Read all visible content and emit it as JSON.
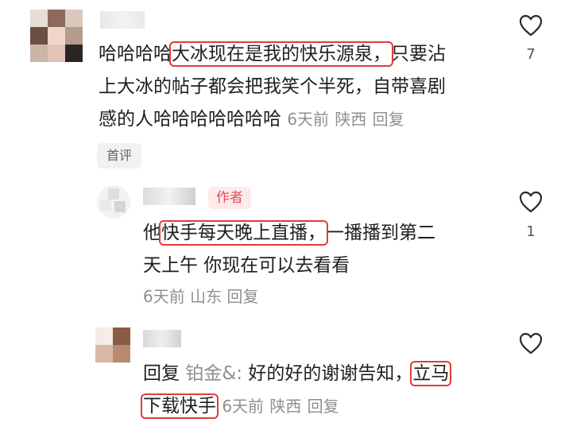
{
  "comments": [
    {
      "id": "c1",
      "text_parts": [
        {
          "text": "哈哈哈哈",
          "highlight": false
        },
        {
          "text": "大冰现在是我的快乐源泉，",
          "highlight": true
        },
        {
          "text": "只要沾",
          "highlight": false
        }
      ],
      "line2": "上大冰的帖子都会把我笑个半死，自带喜剧",
      "line3": "感的人哈哈哈哈哈哈哈",
      "time": "6天前",
      "location": "陕西",
      "reply_label": "回复",
      "likes": "7",
      "badge": "首评"
    },
    {
      "id": "c2",
      "badge": "作者",
      "line1_parts": [
        {
          "text": "他",
          "highlight": false
        },
        {
          "text": "快手每天晚上直播，",
          "highlight": true
        },
        {
          "text": "一播播到第二",
          "highlight": false
        }
      ],
      "line2": "天上午 你现在可以去看看",
      "time": "6天前",
      "location": "山东",
      "reply_label": "回复",
      "likes": "1"
    },
    {
      "id": "c3",
      "prefix": "回复",
      "quoted_name": "铂金&:",
      "body": "好的好的谢谢告知，",
      "highlight1": "立马",
      "highlight2": "下载快手",
      "time": "6天前",
      "location": "陕西",
      "reply_label": "回复",
      "likes": ""
    }
  ],
  "colors": {
    "highlight_box": "#e13b3b",
    "meta_text": "#8f8f8f",
    "author_badge_bg": "#fdebec",
    "author_badge_text": "#e94b5b"
  },
  "icons": [
    "heart-icon"
  ]
}
